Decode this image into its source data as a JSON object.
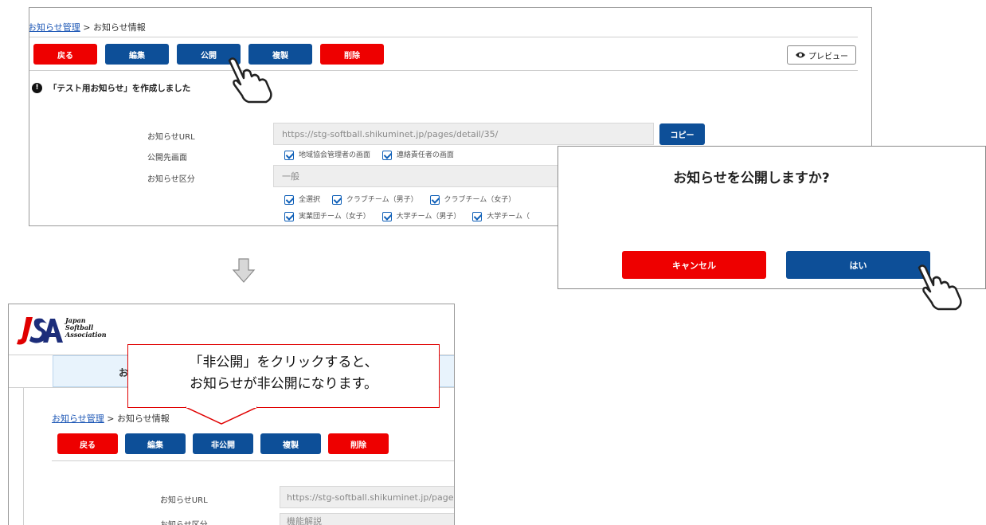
{
  "top_panel": {
    "breadcrumb_link": "お知らせ管理",
    "breadcrumb_sep": " > ",
    "breadcrumb_current": "お知らせ情報",
    "buttons": {
      "back": "戻る",
      "edit": "編集",
      "publish": "公開",
      "copy": "複製",
      "delete": "削除"
    },
    "preview_label": "プレビュー",
    "notice": "「テスト用お知らせ」を作成しました",
    "labels": {
      "url": "お知らせURL",
      "destination": "公開先画面",
      "category": "お知らせ区分"
    },
    "url_value": "https://stg-softball.shikuminet.jp/pages/detail/35/",
    "copy_url_button": "コピー",
    "destinations": [
      "地域協会管理者の画面",
      "連絡責任者の画面"
    ],
    "category_value": "一般",
    "teams_row1": [
      "全選択",
      "クラブチーム（男子）",
      "クラブチーム（女子）"
    ],
    "teams_row2": [
      "実業団チーム（女子）",
      "大学チーム（男子）",
      "大学チーム（"
    ]
  },
  "dialog": {
    "question": "お知らせを公開しますか?",
    "cancel": "キャンセル",
    "yes": "はい"
  },
  "bottom_panel": {
    "logo_text": [
      "Japan",
      "Softball",
      "Association"
    ],
    "logo_mark": "JSA",
    "nav_fragment": "お",
    "callout_line1": "「非公開」をクリックすると、",
    "callout_line2": "お知らせが非公開になります。",
    "breadcrumb_link": "お知らせ管理",
    "breadcrumb_sep": " > ",
    "breadcrumb_current": "お知らせ情報",
    "buttons": {
      "back": "戻る",
      "edit": "編集",
      "unpublish": "非公開",
      "copy": "複製",
      "delete": "削除"
    },
    "labels": {
      "url": "お知らせURL",
      "category": "お知らせ区分"
    },
    "url_value": "https://stg-softball.shikuminet.jp/pages",
    "category_value": "機能解説"
  },
  "colors": {
    "red": "#ee0000",
    "blue": "#0d4f98",
    "callout_border": "#e00000"
  }
}
